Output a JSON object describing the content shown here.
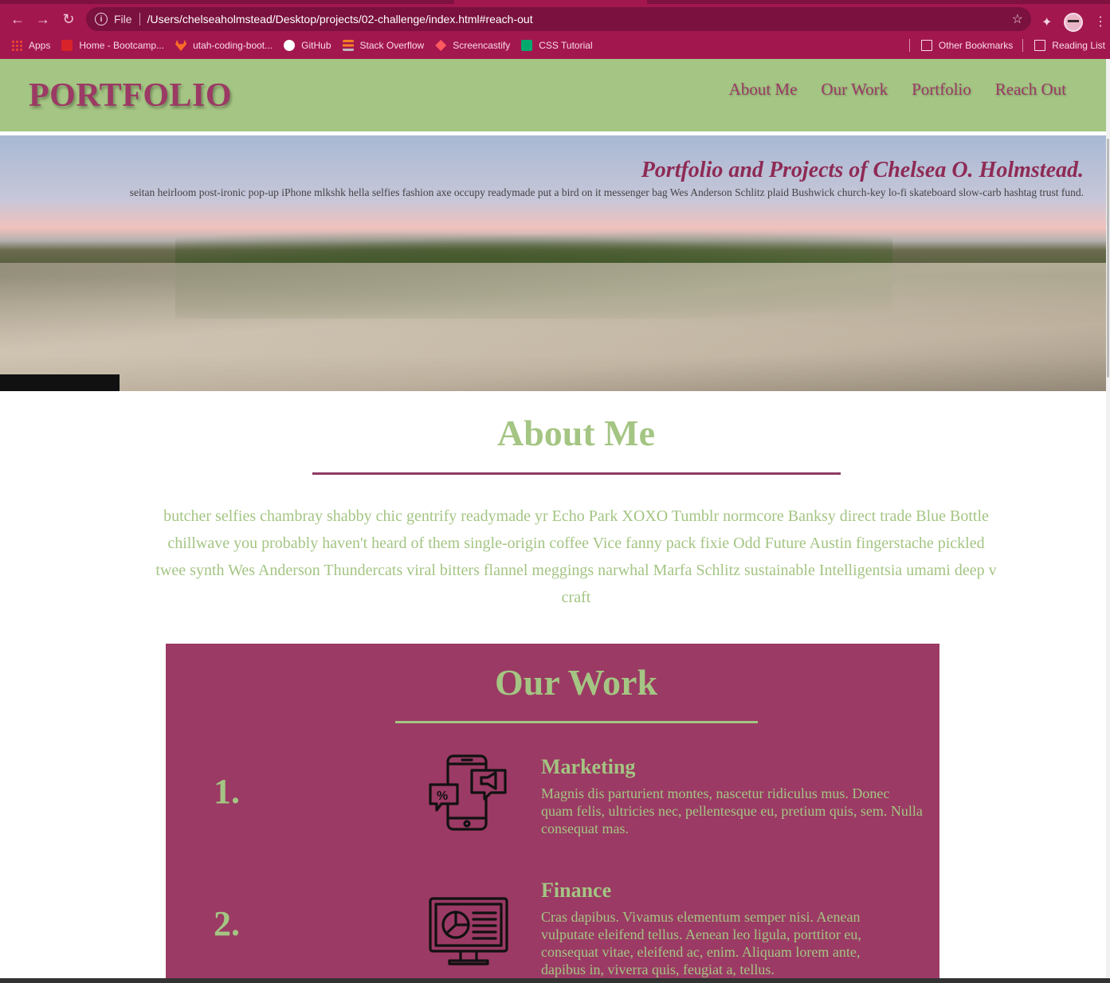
{
  "browser": {
    "url_scheme": "File",
    "url": "/Users/chelseaholmstead/Desktop/projects/02-challenge/index.html#reach-out",
    "bookmarks": [
      {
        "label": "Apps",
        "color": "#e8643c"
      },
      {
        "label": "Home - Bootcamp...",
        "color": "#d8232a"
      },
      {
        "label": "utah-coding-boot...",
        "color": "#fc6d26"
      },
      {
        "label": "GitHub",
        "color": "#ffffff"
      },
      {
        "label": "Stack Overflow",
        "color": "#f48024"
      },
      {
        "label": "Screencastify",
        "color": "#ff5a5f"
      },
      {
        "label": "CSS Tutorial",
        "color": "#04aa6d"
      }
    ],
    "other_bookmarks": "Other Bookmarks",
    "reading_list": "Reading List"
  },
  "site": {
    "logo": "PORTFOLIO",
    "nav": [
      "About Me",
      "Our Work",
      "Portfolio",
      "Reach Out"
    ],
    "hero": {
      "title": "Portfolio and Projects of Chelsea O. Holmstead.",
      "text": "seitan heirloom post-ironic pop-up iPhone mlkshk hella selfies fashion axe occupy readymade put a bird on it messenger bag Wes Anderson Schlitz plaid Bushwick church-key lo-fi skateboard slow-carb hashtag trust fund."
    },
    "about": {
      "title": "About Me",
      "text": "butcher selfies chambray shabby chic gentrify readymade yr Echo Park XOXO Tumblr normcore Banksy direct trade Blue Bottle chillwave you probably haven't heard of them single-origin coffee Vice fanny pack fixie Odd Future Austin fingerstache pickled twee synth Wes Anderson Thundercats viral bitters flannel meggings narwhal Marfa Schlitz sustainable Intelligentsia umami deep v craft"
    },
    "work": {
      "title": "Our Work",
      "items": [
        {
          "number": "1.",
          "icon": "mobile-marketing-icon",
          "heading": "Marketing",
          "body": "Magnis dis parturient montes, nascetur ridiculus mus. Donec quam felis, ultricies nec, pellentesque eu, pretium quis, sem. Nulla consequat mas."
        },
        {
          "number": "2.",
          "icon": "monitor-chart-icon",
          "heading": "Finance",
          "body": "Cras dapibus. Vivamus elementum semper nisi. Aenean vulputate eleifend tellus. Aenean leo ligula, porttitor eu, consequat vitae, eleifend ac, enim. Aliquam lorem ante, dapibus in, viverra quis, feugiat a, tellus."
        }
      ]
    }
  },
  "colors": {
    "chrome": "#a3174f",
    "header_green": "#a4c583",
    "accent_plum": "#9b3a64"
  }
}
